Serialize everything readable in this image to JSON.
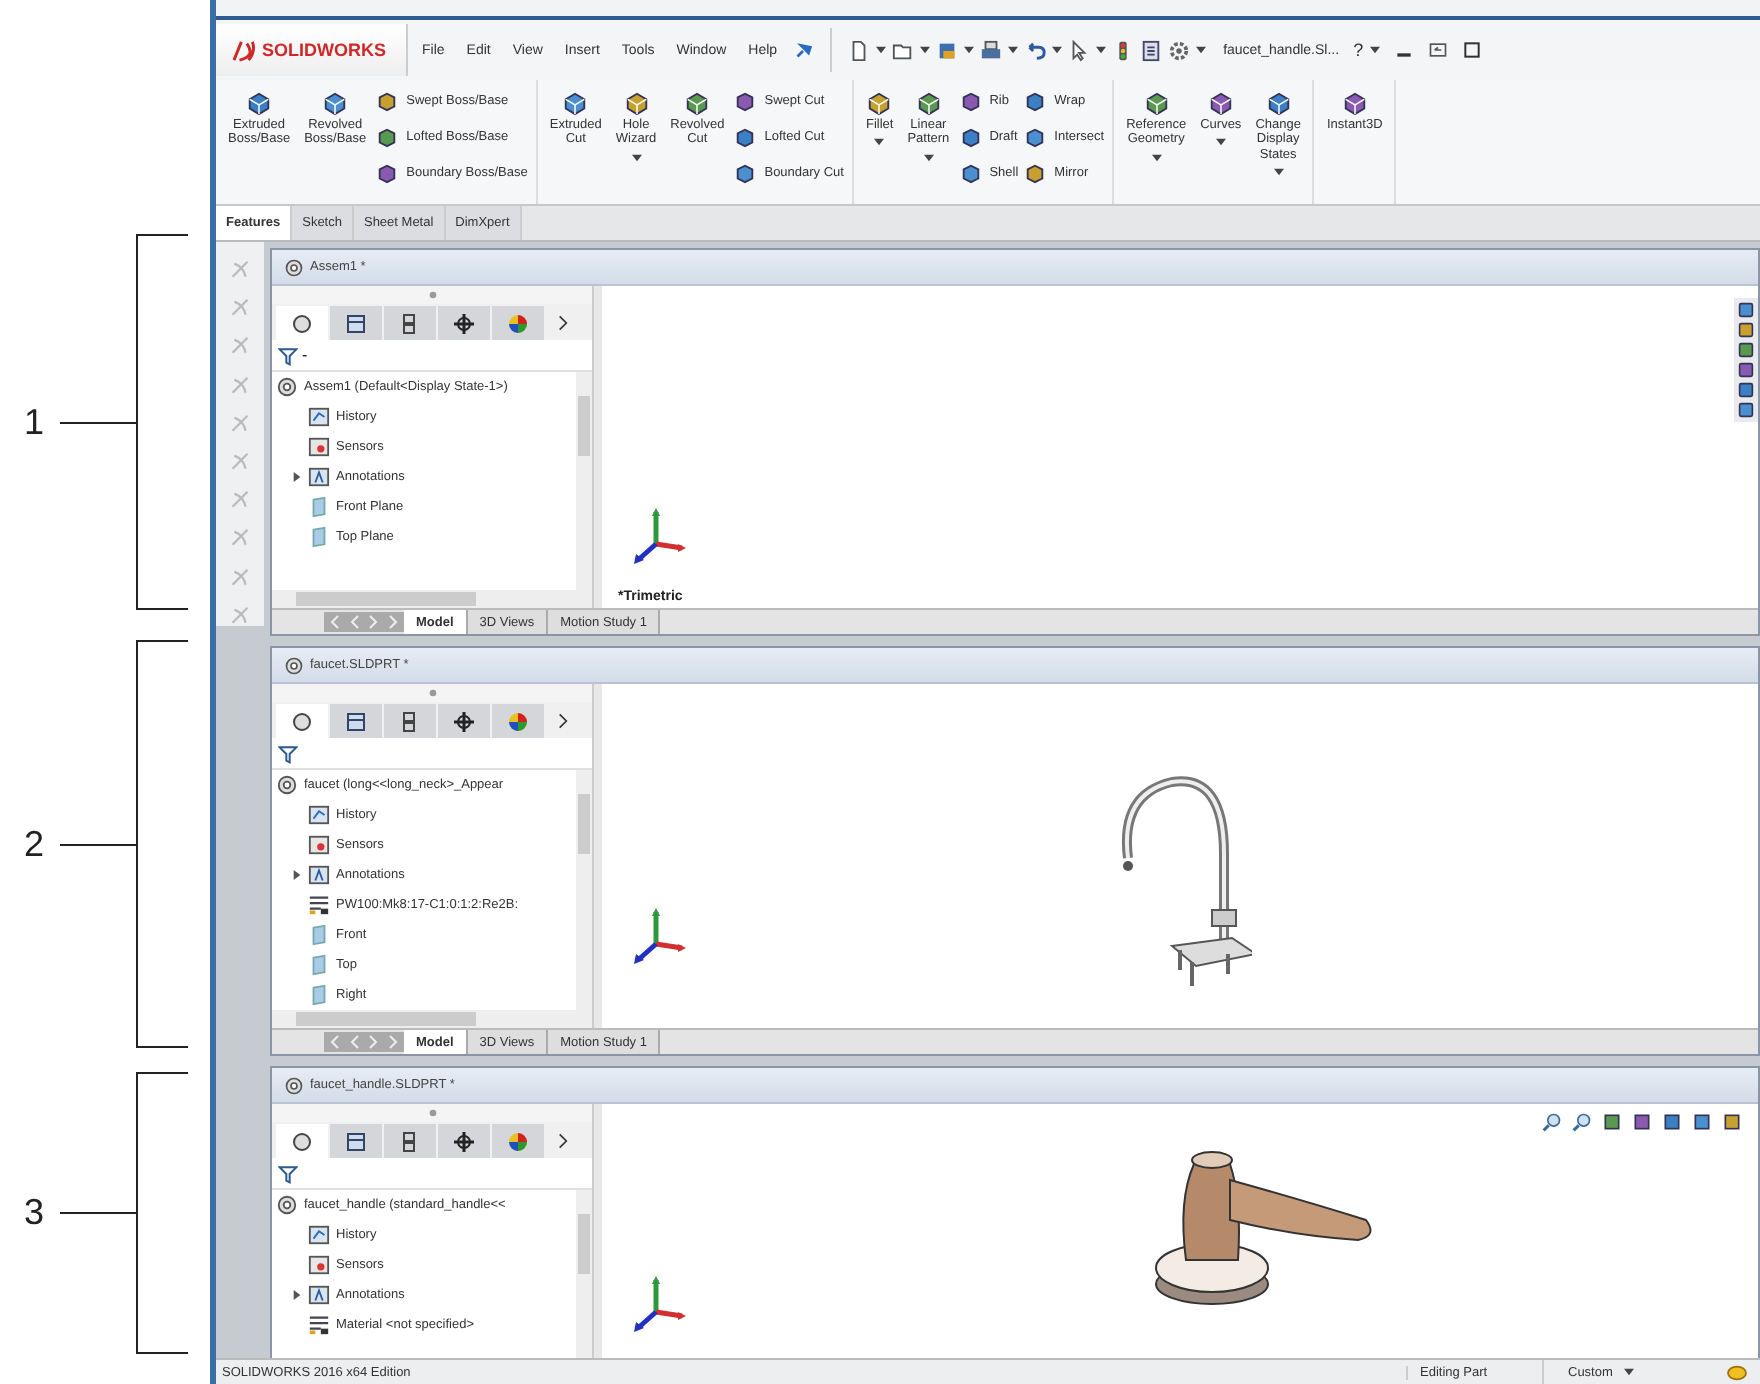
{
  "callouts": [
    {
      "label": "1"
    },
    {
      "label": "2"
    },
    {
      "label": "3"
    }
  ],
  "title_bar": {
    "logo": "SOLIDWORKS",
    "menu": [
      "File",
      "Edit",
      "View",
      "Insert",
      "Tools",
      "Window",
      "Help"
    ],
    "document_name": "faucet_handle.Sl...",
    "help": "?"
  },
  "ribbon": {
    "groups": [
      {
        "items": [
          {
            "kind": "large",
            "label": "Extruded\nBoss/Base",
            "dropdown": false
          },
          {
            "kind": "large",
            "label": "Revolved\nBoss/Base",
            "dropdown": false
          },
          {
            "kind": "stack",
            "labels": [
              "Swept Boss/Base",
              "Lofted Boss/Base",
              "Boundary Boss/Base"
            ]
          }
        ]
      },
      {
        "items": [
          {
            "kind": "large",
            "label": "Extruded\nCut",
            "dropdown": false
          },
          {
            "kind": "large",
            "label": "Hole\nWizard",
            "dropdown": true
          },
          {
            "kind": "large",
            "label": "Revolved\nCut",
            "dropdown": false
          },
          {
            "kind": "stack",
            "labels": [
              "Swept Cut",
              "Lofted Cut",
              "Boundary Cut"
            ]
          }
        ]
      },
      {
        "items": [
          {
            "kind": "large",
            "label": "Fillet",
            "dropdown": true
          },
          {
            "kind": "large",
            "label": "Linear\nPattern",
            "dropdown": true
          },
          {
            "kind": "stack",
            "labels": [
              "Rib",
              "Draft",
              "Shell"
            ]
          },
          {
            "kind": "stack",
            "labels": [
              "Wrap",
              "Intersect",
              "Mirror"
            ]
          }
        ]
      },
      {
        "items": [
          {
            "kind": "large",
            "label": "Reference\nGeometry",
            "dropdown": true
          },
          {
            "kind": "large",
            "label": "Curves",
            "dropdown": true
          },
          {
            "kind": "large",
            "label": "Change\nDisplay\nStates",
            "dropdown": true
          }
        ]
      },
      {
        "items": [
          {
            "kind": "large",
            "label": "Instant3D",
            "dropdown": false
          }
        ]
      }
    ]
  },
  "command_tabs": [
    {
      "label": "Features",
      "selected": true
    },
    {
      "label": "Sketch",
      "selected": false
    },
    {
      "label": "Sheet Metal",
      "selected": false
    },
    {
      "label": "DimXpert",
      "selected": false
    }
  ],
  "documents": [
    {
      "title": "Assem1 *",
      "filter_text": "-",
      "root": "Assem1  (Default<Display State-1>)",
      "tree": [
        {
          "label": "History",
          "kind": "history",
          "expandable": false
        },
        {
          "label": "Sensors",
          "kind": "sensors",
          "expandable": false
        },
        {
          "label": "Annotations",
          "kind": "annotations",
          "expandable": true
        },
        {
          "label": "Front Plane",
          "kind": "plane",
          "expandable": false
        },
        {
          "label": "Top Plane",
          "kind": "plane",
          "expandable": false
        }
      ],
      "view_label": "*Trimetric",
      "kind": "empty",
      "panel_tabs": [
        {
          "selected": true
        },
        {
          "selected": false
        },
        {
          "selected": false
        },
        {
          "selected": false
        },
        {
          "selected": false
        }
      ],
      "task_pane": true,
      "view_toolbar": false,
      "bottom_tabs": [
        {
          "label": "Model",
          "selected": true
        },
        {
          "label": "3D Views",
          "selected": false
        },
        {
          "label": "Motion Study 1",
          "selected": false
        }
      ]
    },
    {
      "title": "faucet.SLDPRT *",
      "root": "faucet  (long<<long_neck>_Appear",
      "tree": [
        {
          "label": "History",
          "kind": "history",
          "expandable": false
        },
        {
          "label": "Sensors",
          "kind": "sensors",
          "expandable": false
        },
        {
          "label": "Annotations",
          "kind": "annotations",
          "expandable": true
        },
        {
          "label": "PW100:Mk8:17-C1:0:1:2:Re2B:",
          "kind": "material",
          "expandable": false
        },
        {
          "label": "Front",
          "kind": "plane",
          "expandable": false
        },
        {
          "label": "Top",
          "kind": "plane",
          "expandable": false
        },
        {
          "label": "Right",
          "kind": "plane",
          "expandable": false
        }
      ],
      "kind": "faucet",
      "panel_tabs": [
        {
          "selected": true
        },
        {
          "selected": false
        },
        {
          "selected": false
        },
        {
          "selected": false
        },
        {
          "selected": false
        }
      ],
      "task_pane": false,
      "view_toolbar": false,
      "bottom_tabs": [
        {
          "label": "Model",
          "selected": true
        },
        {
          "label": "3D Views",
          "selected": false
        },
        {
          "label": "Motion Study 1",
          "selected": false
        }
      ]
    },
    {
      "title": "faucet_handle.SLDPRT *",
      "root": "faucet_handle  (standard_handle<<",
      "tree": [
        {
          "label": "History",
          "kind": "history",
          "expandable": false
        },
        {
          "label": "Sensors",
          "kind": "sensors",
          "expandable": false
        },
        {
          "label": "Annotations",
          "kind": "annotations",
          "expandable": true
        },
        {
          "label": "Material <not specified>",
          "kind": "material",
          "expandable": false
        }
      ],
      "kind": "handle",
      "panel_tabs": [
        {
          "selected": true
        },
        {
          "selected": false
        },
        {
          "selected": false
        },
        {
          "selected": false
        },
        {
          "selected": false
        }
      ],
      "task_pane": false,
      "view_toolbar": true
    }
  ],
  "status_bar": {
    "edition": "SOLIDWORKS 2016 x64 Edition",
    "mode": "Editing Part",
    "units": "Custom"
  }
}
